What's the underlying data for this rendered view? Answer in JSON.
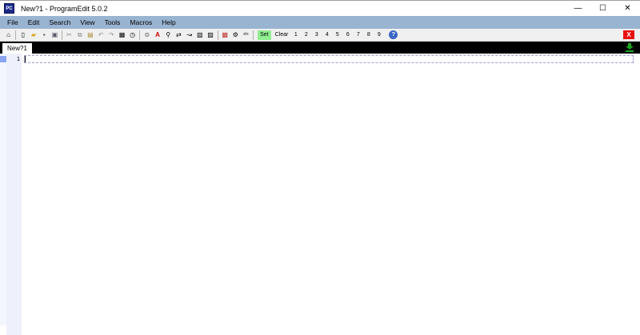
{
  "window": {
    "app_icon_text": "PC",
    "title": "New?1  -  ProgramEdit 5.0.2",
    "minimize": "—",
    "maximize": "☐",
    "close": "✕"
  },
  "menu": [
    "File",
    "Edit",
    "Search",
    "View",
    "Tools",
    "Macros",
    "Help"
  ],
  "toolbar": {
    "icons_group1": [
      {
        "name": "home-icon",
        "glyph": "⌂"
      }
    ],
    "icons_group2": [
      {
        "name": "new-file-icon",
        "glyph": "▯"
      },
      {
        "name": "open-folder-icon",
        "glyph": "▰"
      },
      {
        "name": "save-icon",
        "glyph": "▪"
      },
      {
        "name": "save-all-icon",
        "glyph": "▣"
      }
    ],
    "icons_group3": [
      {
        "name": "cut-icon",
        "glyph": "✂"
      },
      {
        "name": "copy-icon",
        "glyph": "⧉"
      },
      {
        "name": "paste-icon",
        "glyph": "▤"
      },
      {
        "name": "undo-icon",
        "glyph": "↶"
      },
      {
        "name": "redo-icon",
        "glyph": "↷"
      },
      {
        "name": "date-icon",
        "glyph": "▦"
      },
      {
        "name": "clock-icon",
        "glyph": "◷"
      }
    ],
    "icons_group4": [
      {
        "name": "bracket-icon",
        "glyph": "⊜"
      },
      {
        "name": "font-color-icon",
        "glyph": "A"
      },
      {
        "name": "find-icon",
        "glyph": "⚲"
      },
      {
        "name": "replace-icon",
        "glyph": "⇄"
      },
      {
        "name": "goto-icon",
        "glyph": "↝"
      },
      {
        "name": "bookmark-toggle-icon",
        "glyph": "▧"
      },
      {
        "name": "bookmark-clear-icon",
        "glyph": "▨"
      }
    ],
    "icons_group5": [
      {
        "name": "color-palette-icon",
        "glyph": "▩"
      },
      {
        "name": "settings-gear-icon",
        "glyph": "⚙"
      },
      {
        "name": "spell-check-icon",
        "glyph": "ᵃᵇᶜ"
      }
    ],
    "set_label": "Set",
    "clear_label": "Clear",
    "bookmarks": [
      "1",
      "2",
      "3",
      "4",
      "5",
      "6",
      "7",
      "8",
      "9"
    ],
    "help_glyph": "?",
    "close_glyph": "X"
  },
  "tabs": [
    {
      "label": "New?1"
    }
  ],
  "editor": {
    "line_numbers": [
      "1"
    ],
    "content": ""
  },
  "colors": {
    "menubar": "#99b4d1",
    "tabstrip": "#000000",
    "set_button": "#90ee90",
    "close_button": "#e81010",
    "gutter": "#eef1fc",
    "download_arrow": "#1aa81a"
  }
}
